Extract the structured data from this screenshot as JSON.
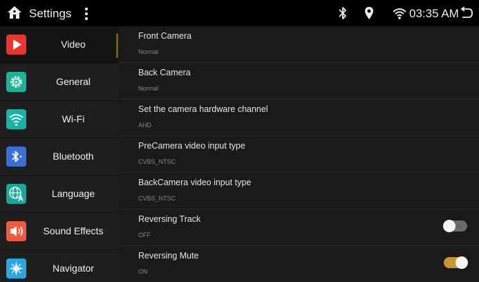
{
  "statusbar": {
    "title": "Settings",
    "time": "03:35 AM",
    "icons": [
      "home-icon",
      "menu-dots-icon",
      "bluetooth-icon",
      "location-icon",
      "wifi-icon",
      "back-icon"
    ]
  },
  "sidebar": {
    "items": [
      {
        "label": "Video",
        "icon": "video-play-icon",
        "color": "#e8362d",
        "active": true
      },
      {
        "label": "General",
        "icon": "gear-icon",
        "color": "#1ab394"
      },
      {
        "label": "Wi-Fi",
        "icon": "wifi-icon",
        "color": "#17b2a6"
      },
      {
        "label": "Bluetooth",
        "icon": "bluetooth-icon",
        "color": "#3b6fd8"
      },
      {
        "label": "Language",
        "icon": "language-icon",
        "color": "#16a89c"
      },
      {
        "label": "Sound Effects",
        "icon": "speaker-icon",
        "color": "#ee5a3a"
      },
      {
        "label": "Navigator",
        "icon": "compass-icon",
        "color": "#2aa6e0"
      }
    ]
  },
  "settings": [
    {
      "title": "Front Camera",
      "value": "Normal"
    },
    {
      "title": "Back Camera",
      "value": "Normal"
    },
    {
      "title": "Set the camera hardware channel",
      "value": "AHD"
    },
    {
      "title": "PreCamera video input type",
      "value": "CVBS_NTSC"
    },
    {
      "title": "BackCamera video input type",
      "value": "CVBS_NTSC"
    },
    {
      "title": "Reversing Track",
      "value": "OFF",
      "toggle": "off"
    },
    {
      "title": "Reversing Mute",
      "value": "ON",
      "toggle": "on"
    }
  ],
  "colors": {
    "toggle_on": "#c8962e",
    "toggle_off": "#6b6b6b",
    "background": "#1a1a1a"
  }
}
